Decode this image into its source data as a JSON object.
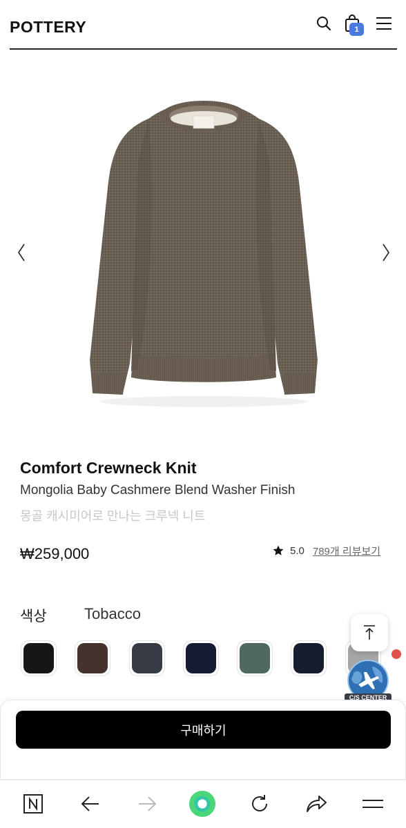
{
  "header": {
    "logo": "POTTERY",
    "cart_count": "1"
  },
  "gallery": {
    "prev_arrow": "〈",
    "next_arrow": "〉"
  },
  "product": {
    "title": "Comfort Crewneck Knit",
    "subtitle": "Mongolia Baby Cashmere Blend Washer Finish",
    "description": "몽골 캐시미어로 만나는 크루넥 니트",
    "price": "₩259,000",
    "rating": "5.0",
    "review_link": "789개 리뷰보기"
  },
  "color": {
    "label": "색상",
    "selected": "Tobacco",
    "swatches": [
      "#161616",
      "#46322d",
      "#363b45",
      "#151b33",
      "#4f6962",
      "#171c2e",
      "#a6a6a6"
    ]
  },
  "floating": {
    "cs_label": "C/S CENTER"
  },
  "purchase": {
    "buy_label": "구매하기"
  },
  "colors": {
    "accent": "#4a7ae0",
    "buy_button": "#000000",
    "nav_home": "#4cd67a"
  }
}
